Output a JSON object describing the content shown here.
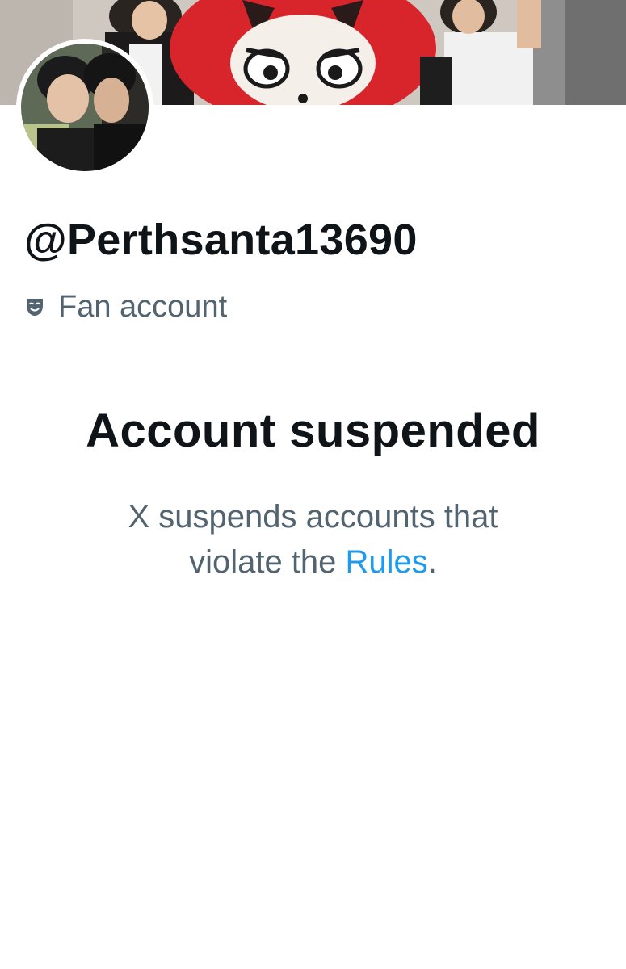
{
  "profile": {
    "handle": "@Perthsanta13690",
    "category_label": "Fan account",
    "category_icon": "theater-mask-icon"
  },
  "suspension": {
    "title": "Account suspended",
    "message_line1": "X suspends accounts that",
    "message_prefix": "violate the ",
    "rules_link": "Rules",
    "message_suffix": "."
  },
  "colors": {
    "text_primary": "#0f1419",
    "text_secondary": "#536471",
    "link": "#1d9bf0",
    "background": "#ffffff"
  }
}
